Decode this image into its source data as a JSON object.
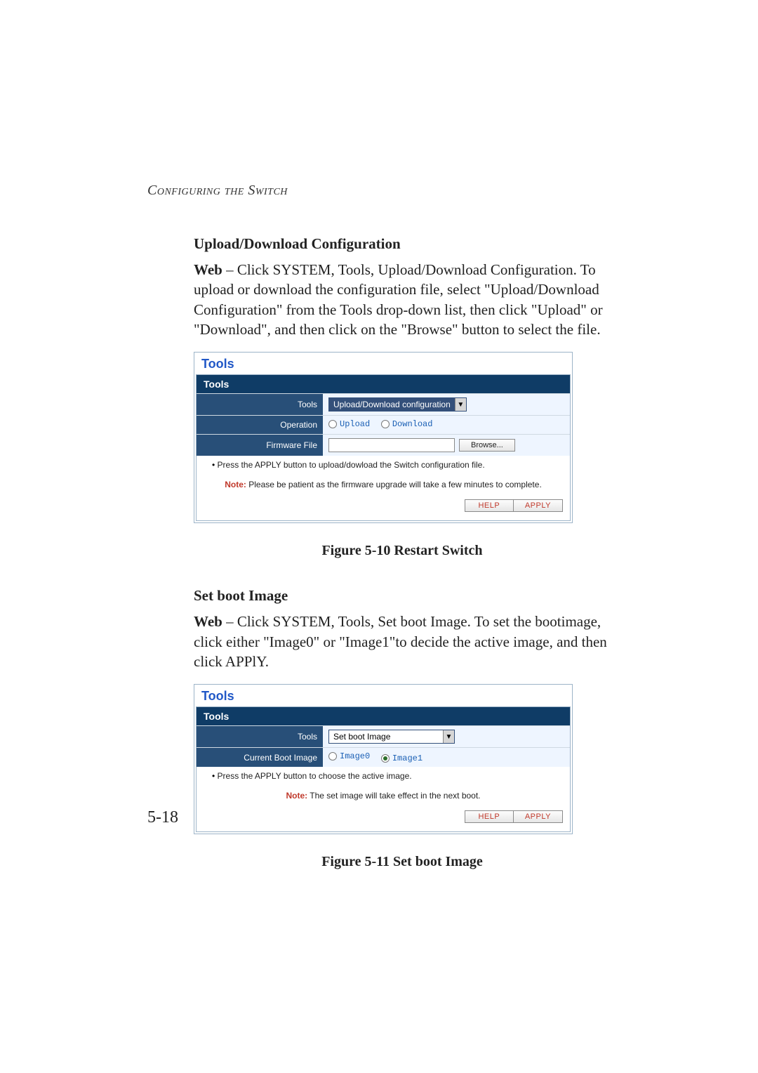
{
  "running_head": "Configuring the Switch",
  "page_number": "5-18",
  "section1": {
    "title": "Upload/Download Configuration",
    "lead": "Web",
    "body": " – Click SYSTEM, Tools, Upload/Download Configuration. To upload or download the configuration file, select \"Upload/Download Configuration\" from the Tools drop-down list, then click \"Upload\" or \"Download\", and then click on the \"Browse\" button to select the file."
  },
  "fig1": {
    "outer_title": "Tools",
    "sub_title": "Tools",
    "rows": {
      "tools_label": "Tools",
      "tools_value": "Upload/Download configuration",
      "operation_label": "Operation",
      "op_upload": "Upload",
      "op_download": "Download",
      "firmware_label": "Firmware File",
      "browse": "Browse..."
    },
    "bullet": "Press the APPLY button to upload/dowload the Switch configuration file.",
    "note_label": "Note:",
    "note_text": " Please be patient as the firmware upgrade will take a few minutes to complete.",
    "help": "HELP",
    "apply": "APPLY",
    "caption": "Figure 5-10  Restart Switch"
  },
  "section2": {
    "title": "Set boot Image",
    "lead": "Web",
    "body": " – Click SYSTEM, Tools, Set boot Image. To set the bootimage, click either \"Image0\" or \"Image1\"to decide the active image, and then click APPlY."
  },
  "fig2": {
    "outer_title": "Tools",
    "sub_title": "Tools",
    "rows": {
      "tools_label": "Tools",
      "tools_value": "Set boot Image",
      "boot_label": "Current Boot Image",
      "image0": "Image0",
      "image1": "Image1"
    },
    "bullet": "Press the APPLY button to choose the active image.",
    "note_label": "Note:",
    "note_text": " The set image will take effect in the next boot.",
    "help": "HELP",
    "apply": "APPLY",
    "caption": "Figure 5-11  Set boot Image"
  }
}
